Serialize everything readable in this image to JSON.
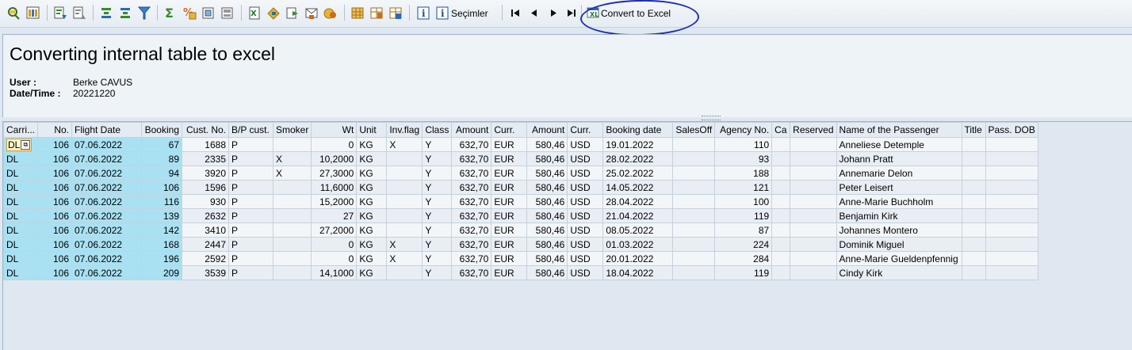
{
  "toolbar": {
    "icons": [
      "detail-icon",
      "choose-layout-icon",
      "sort-ascending-icon",
      "sort-descending-icon",
      "find-icon",
      "find-next-icon",
      "filter-icon",
      "sum-icon",
      "subtotal-icon",
      "print-preview-icon",
      "export-icon",
      "spreadsheet-icon",
      "word-processing-icon",
      "local-file-icon",
      "mail-icon",
      "abc-analysis-icon",
      "graphic-icon",
      "change-layout-icon",
      "select-layout-icon",
      "save-layout-icon",
      "info-icon",
      "selections-icon",
      "first-page-icon",
      "previous-page-icon",
      "next-page-icon",
      "last-page-icon",
      "convert-excel-icon"
    ],
    "selections_label": "Seçimler",
    "convert_label": "Convert to Excel"
  },
  "header": {
    "title": "Converting internal table to excel",
    "user_label": "User :",
    "user_value": "Berke CAVUS",
    "datetime_label": "Date/Time :",
    "datetime_value": "20221220"
  },
  "grid": {
    "columns": [
      "Carri...",
      "No.",
      "Flight Date",
      "Booking",
      "Cust. No.",
      "B/P cust.",
      "Smoker",
      "Wt",
      "Unit",
      "Inv.flag",
      "Class",
      "Amount",
      "Curr.",
      "Amount",
      "Curr.",
      "Booking date",
      "SalesOff",
      "Agency No.",
      "Ca",
      "Reserved",
      "Name of the Passenger",
      "Title",
      "Pass. DOB"
    ],
    "rows": [
      [
        "DL",
        "106",
        "07.06.2022",
        "67",
        "1688",
        "P",
        "",
        "0",
        "KG",
        "X",
        "Y",
        "632,70",
        "EUR",
        "580,46",
        "USD",
        "19.01.2022",
        "",
        "110",
        "",
        "",
        "Anneliese Detemple",
        "",
        ""
      ],
      [
        "DL",
        "106",
        "07.06.2022",
        "89",
        "2335",
        "P",
        "X",
        "10,2000",
        "KG",
        "",
        "Y",
        "632,70",
        "EUR",
        "580,46",
        "USD",
        "28.02.2022",
        "",
        "93",
        "",
        "",
        "Johann Pratt",
        "",
        ""
      ],
      [
        "DL",
        "106",
        "07.06.2022",
        "94",
        "3920",
        "P",
        "X",
        "27,3000",
        "KG",
        "",
        "Y",
        "632,70",
        "EUR",
        "580,46",
        "USD",
        "25.02.2022",
        "",
        "188",
        "",
        "",
        "Annemarie Delon",
        "",
        ""
      ],
      [
        "DL",
        "106",
        "07.06.2022",
        "106",
        "1596",
        "P",
        "",
        "11,6000",
        "KG",
        "",
        "Y",
        "632,70",
        "EUR",
        "580,46",
        "USD",
        "14.05.2022",
        "",
        "121",
        "",
        "",
        "Peter Leisert",
        "",
        ""
      ],
      [
        "DL",
        "106",
        "07.06.2022",
        "116",
        "930",
        "P",
        "",
        "15,2000",
        "KG",
        "",
        "Y",
        "632,70",
        "EUR",
        "580,46",
        "USD",
        "28.04.2022",
        "",
        "100",
        "",
        "",
        "Anne-Marie Buchholm",
        "",
        ""
      ],
      [
        "DL",
        "106",
        "07.06.2022",
        "139",
        "2632",
        "P",
        "",
        "27",
        "KG",
        "",
        "Y",
        "632,70",
        "EUR",
        "580,46",
        "USD",
        "21.04.2022",
        "",
        "119",
        "",
        "",
        "Benjamin Kirk",
        "",
        ""
      ],
      [
        "DL",
        "106",
        "07.06.2022",
        "142",
        "3410",
        "P",
        "",
        "27,2000",
        "KG",
        "",
        "Y",
        "632,70",
        "EUR",
        "580,46",
        "USD",
        "08.05.2022",
        "",
        "87",
        "",
        "",
        "Johannes Montero",
        "",
        ""
      ],
      [
        "DL",
        "106",
        "07.06.2022",
        "168",
        "2447",
        "P",
        "",
        "0",
        "KG",
        "X",
        "Y",
        "632,70",
        "EUR",
        "580,46",
        "USD",
        "01.03.2022",
        "",
        "224",
        "",
        "",
        "Dominik Miguel",
        "",
        ""
      ],
      [
        "DL",
        "106",
        "07.06.2022",
        "196",
        "2592",
        "P",
        "",
        "0",
        "KG",
        "X",
        "Y",
        "632,70",
        "EUR",
        "580,46",
        "USD",
        "20.01.2022",
        "",
        "284",
        "",
        "",
        "Anne-Marie Gueldenpfennig",
        "",
        ""
      ],
      [
        "DL",
        "106",
        "07.06.2022",
        "209",
        "3539",
        "P",
        "",
        "14,1000",
        "KG",
        "",
        "Y",
        "632,70",
        "EUR",
        "580,46",
        "USD",
        "18.04.2022",
        "",
        "119",
        "",
        "",
        "Cindy Kirk",
        "",
        ""
      ]
    ]
  },
  "colors": {
    "key_column": "#a9e1f2",
    "highlight_oval": "#1f2fb0"
  }
}
